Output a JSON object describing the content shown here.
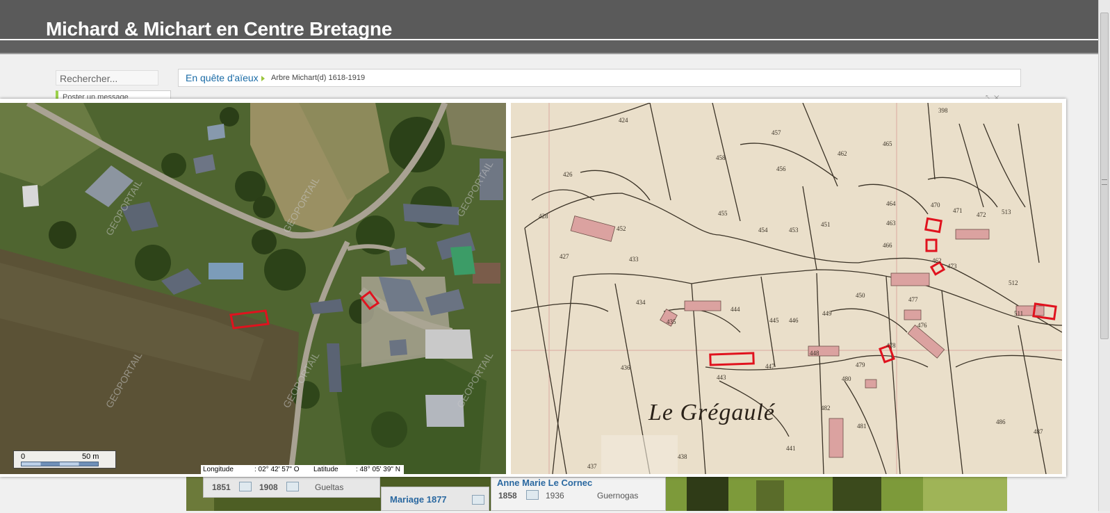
{
  "header": {
    "site_title": "Michard & Michart en Centre Bretagne"
  },
  "search": {
    "placeholder": "Rechercher..."
  },
  "message": {
    "label": "Poster un message"
  },
  "breadcrumb": {
    "home": "En quête d'aïeux",
    "current": "Arbre Michart(d) 1618-1919"
  },
  "aerial": {
    "watermark": "GEOPORTAIL",
    "scale": {
      "start": "0",
      "end": "50 m"
    },
    "coords": {
      "lon_label": "Longitude",
      "lon_value": ": 02° 42' 57\" O",
      "lat_label": "Latitude",
      "lat_value": ": 48° 05' 39\" N"
    },
    "marker_color": "#e0121e"
  },
  "cadastre": {
    "place_name": "Le Grégaulé"
  },
  "bottom": {
    "card1": {
      "year1": "1851",
      "year2": "1908",
      "place": "Gueltas"
    },
    "card2": {
      "title": "Mariage 1877"
    },
    "card3": {
      "name": "Anne Marie Le Cornec",
      "year1": "1858",
      "year2": "1936",
      "place": "Guernogas"
    }
  }
}
